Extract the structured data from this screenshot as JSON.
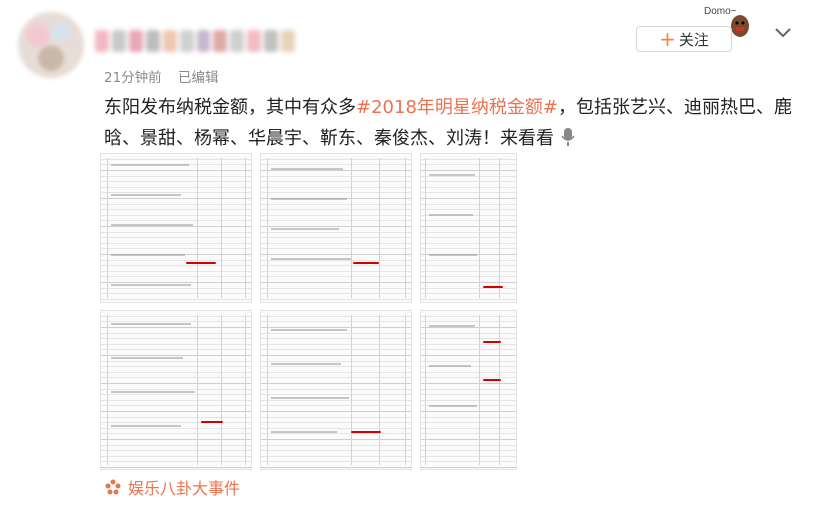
{
  "post": {
    "time": "21分钟前",
    "edited": "已编辑",
    "text_before": "东阳发布纳税金额，其中有众多",
    "topic": "#2018年明星纳税金额#",
    "text_after": "，包括张艺兴、迪丽热巴、鹿晗、景甜、杨幂、华晨宇、靳东、秦俊杰、刘涛！来看看"
  },
  "header": {
    "follow_plus": "+",
    "follow_label": "关注",
    "mascot_label": "Domo~"
  },
  "footer": {
    "source": "娱乐八卦大事件"
  },
  "icons": {
    "mic": "microphone-icon",
    "chevron": "chevron-down-icon",
    "source": "flower-icon"
  },
  "colors": {
    "topic": "#eb7350",
    "plus": "#ff8140",
    "highlight": "#d40000"
  }
}
